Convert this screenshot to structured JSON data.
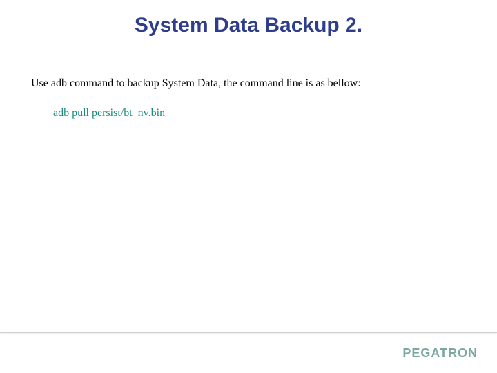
{
  "title": "System Data Backup 2.",
  "instruction": "Use adb command to backup System Data, the command line is as bellow:",
  "command": "adb pull persist/bt_nv.bin",
  "footer_logo": "PEGATRON"
}
